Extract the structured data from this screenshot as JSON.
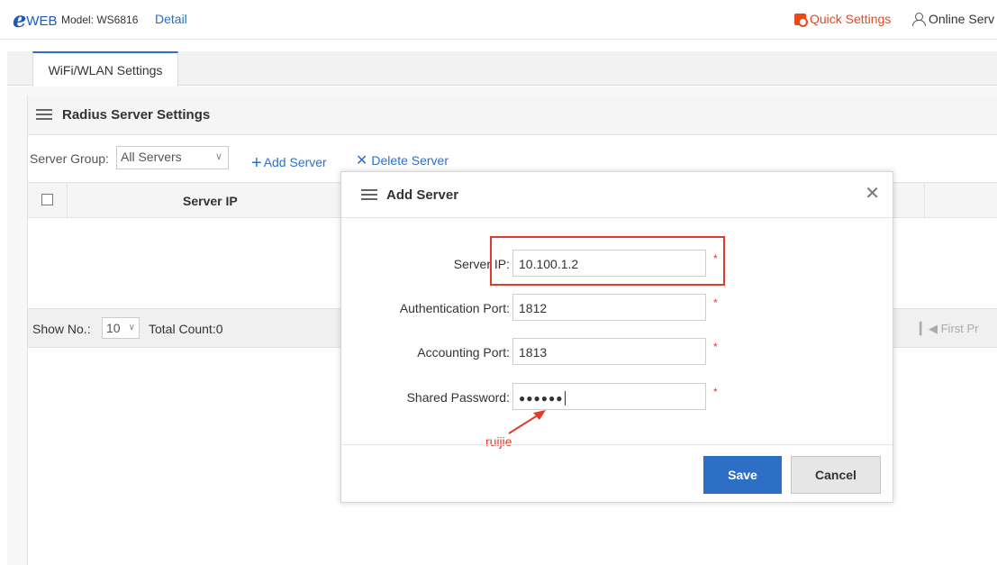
{
  "header": {
    "logo_e": "e",
    "logo_web": "WEB",
    "model": "Model: WS6816",
    "detail_link": "Detail",
    "quick_settings": "Quick Settings",
    "online_service": "Online Serv"
  },
  "tabs": [
    {
      "label": "WiFi/WLAN Settings",
      "active": true
    }
  ],
  "panel": {
    "title": "Radius Server Settings",
    "server_group_label": "Server Group:",
    "server_group_value": "All Servers",
    "add_server": "Add Server",
    "delete_server": "Delete Server",
    "table_columns": [
      "Server IP"
    ],
    "show_no_label": "Show No.:",
    "show_no_value": "10",
    "total_count": "Total Count:0",
    "pager_text": "First  Pr"
  },
  "modal": {
    "title": "Add Server",
    "fields": [
      {
        "label": "Server IP:",
        "value": "10.100.1.2",
        "required": "*"
      },
      {
        "label": "Authentication Port:",
        "value": "1812",
        "required": "*"
      },
      {
        "label": "Accounting Port:",
        "value": "1813",
        "required": "*"
      },
      {
        "label": "Shared Password:",
        "value": "●●●●●●",
        "required": "*"
      }
    ],
    "annotation": "ruijie",
    "save_label": "Save",
    "cancel_label": "Cancel"
  },
  "colors": {
    "accent": "#2e6fc6",
    "quick_settings": "#e8481c",
    "annotation_red": "#e23b2e"
  }
}
